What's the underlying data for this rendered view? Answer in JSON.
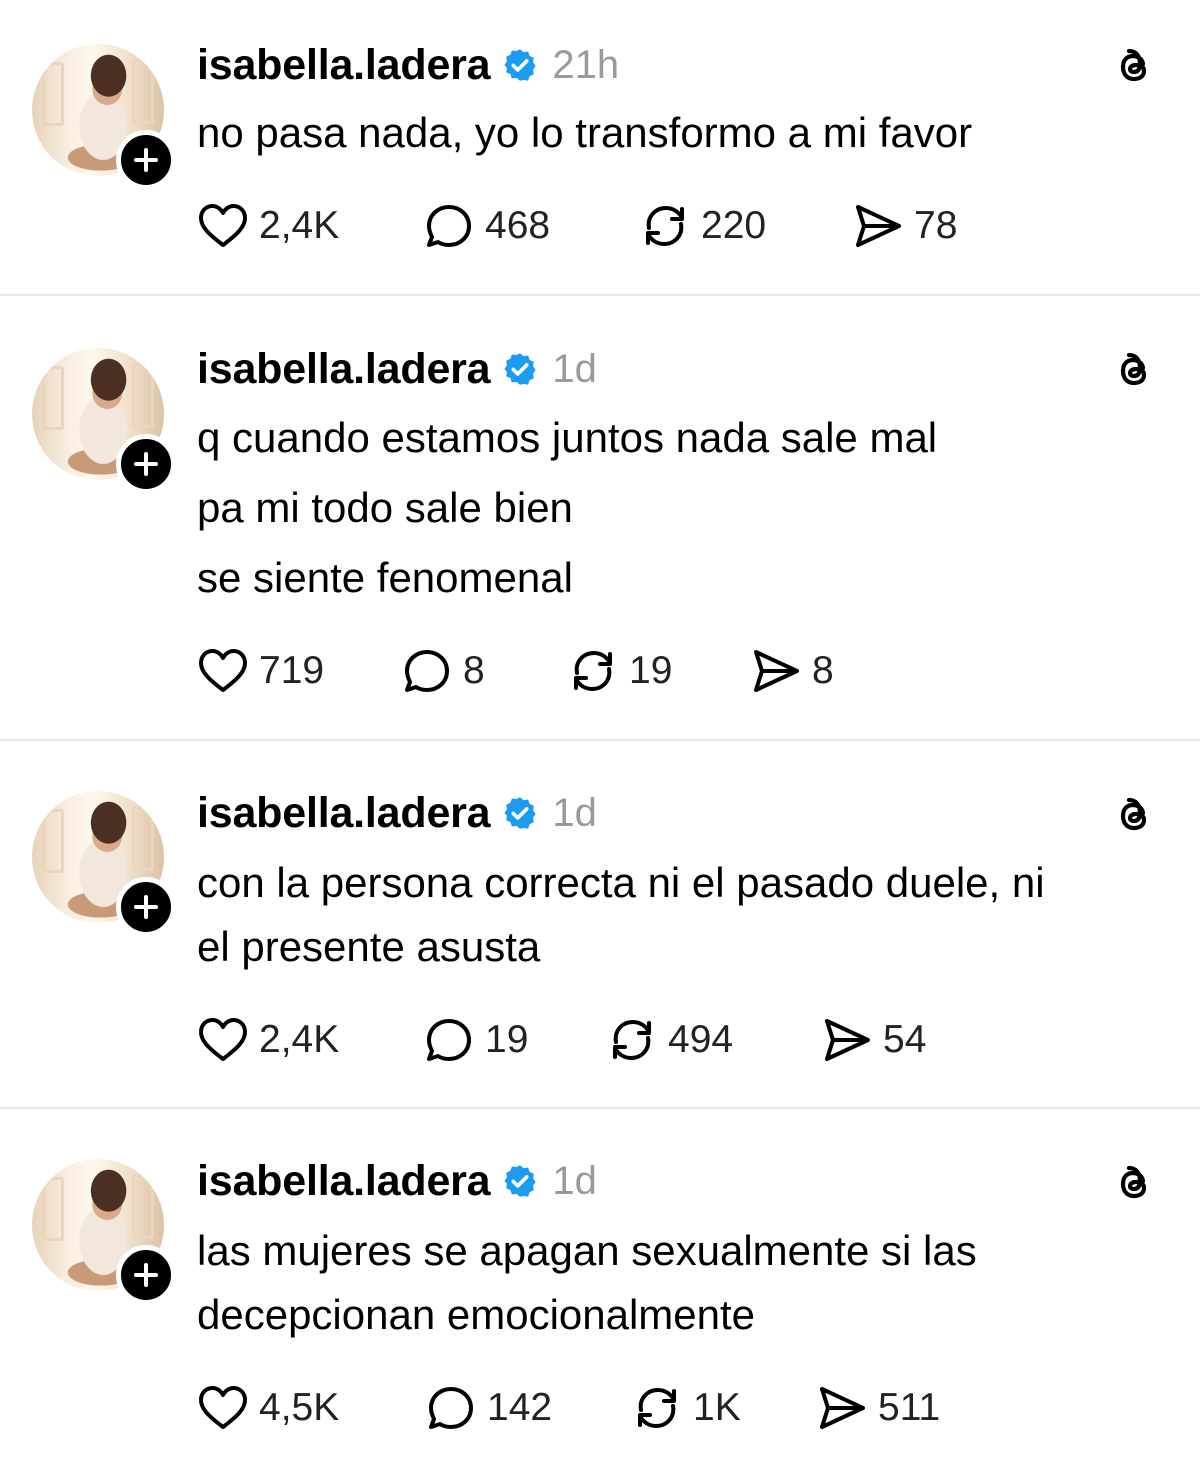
{
  "posts": [
    {
      "username": "isabella.ladera",
      "time": "21h",
      "lines": [
        "no pasa nada, yo lo transformo a mi favor"
      ],
      "likes": "2,4K",
      "replies": "468",
      "reposts": "220",
      "shares": "78"
    },
    {
      "username": "isabella.ladera",
      "time": "1d",
      "lines": [
        "q cuando estamos juntos nada sale mal",
        "pa mi todo sale bien",
        "se siente fenomenal"
      ],
      "likes": "719",
      "replies": "8",
      "reposts": "19",
      "shares": "8"
    },
    {
      "username": "isabella.ladera",
      "time": "1d",
      "lines": [
        "con la persona correcta ni el pasado duele, ni",
        "el presente asusta"
      ],
      "likes": "2,4K",
      "replies": "19",
      "reposts": "494",
      "shares": "54"
    },
    {
      "username": "isabella.ladera",
      "time": "1d",
      "lines": [
        "las mujeres se apagan sexualmente si las",
        "decepcionan emocionalmente"
      ],
      "likes": "4,5K",
      "replies": "142",
      "reposts": "1K",
      "shares": "511"
    }
  ],
  "icons": {
    "verified": "verified-badge-icon",
    "platform": "threads-logo-icon",
    "follow": "plus-icon",
    "like": "heart-icon",
    "reply": "comment-bubble-icon",
    "repost": "repost-icon",
    "share": "send-icon"
  },
  "colors": {
    "verified": "#1d9bf0",
    "time": "#9a9a9a",
    "divider": "#e7e7e7"
  }
}
